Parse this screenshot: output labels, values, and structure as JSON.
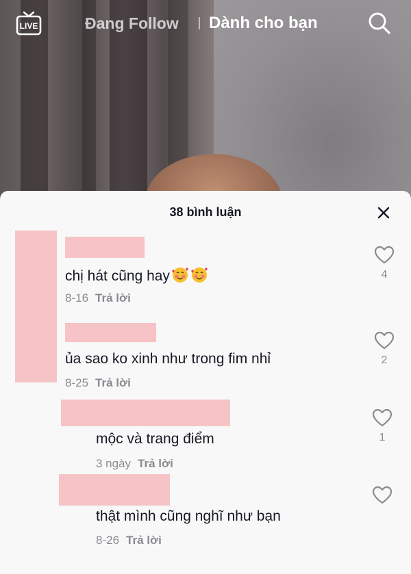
{
  "top_nav": {
    "live_icon": "live-tv-icon",
    "live_label": "LIVE",
    "following_tab": "Đang Follow",
    "for_you_tab": "Dành cho bạn",
    "search_icon": "search-icon"
  },
  "comments_panel": {
    "title": "38 bình luận",
    "close_icon": "close-icon",
    "reply_label": "Trả lời",
    "comments": [
      {
        "text": "chị hát cũng hay",
        "emoji": "smiling-face-with-hearts",
        "date": "8-16",
        "likes": "4"
      },
      {
        "text": "ủa sao ko xinh như trong fim nhỉ",
        "date": "8-25",
        "likes": "2"
      },
      {
        "text": "mộc và trang điểm",
        "date": "3 ngày",
        "likes": "1"
      },
      {
        "text": "thật mình cũng nghĩ như bạn",
        "date": "8-26",
        "likes": ""
      }
    ]
  },
  "colors": {
    "sheet_bg": "#f8f8f8",
    "redaction": "#f6c4c6",
    "text": "#161823",
    "muted": "#8a8b91"
  }
}
